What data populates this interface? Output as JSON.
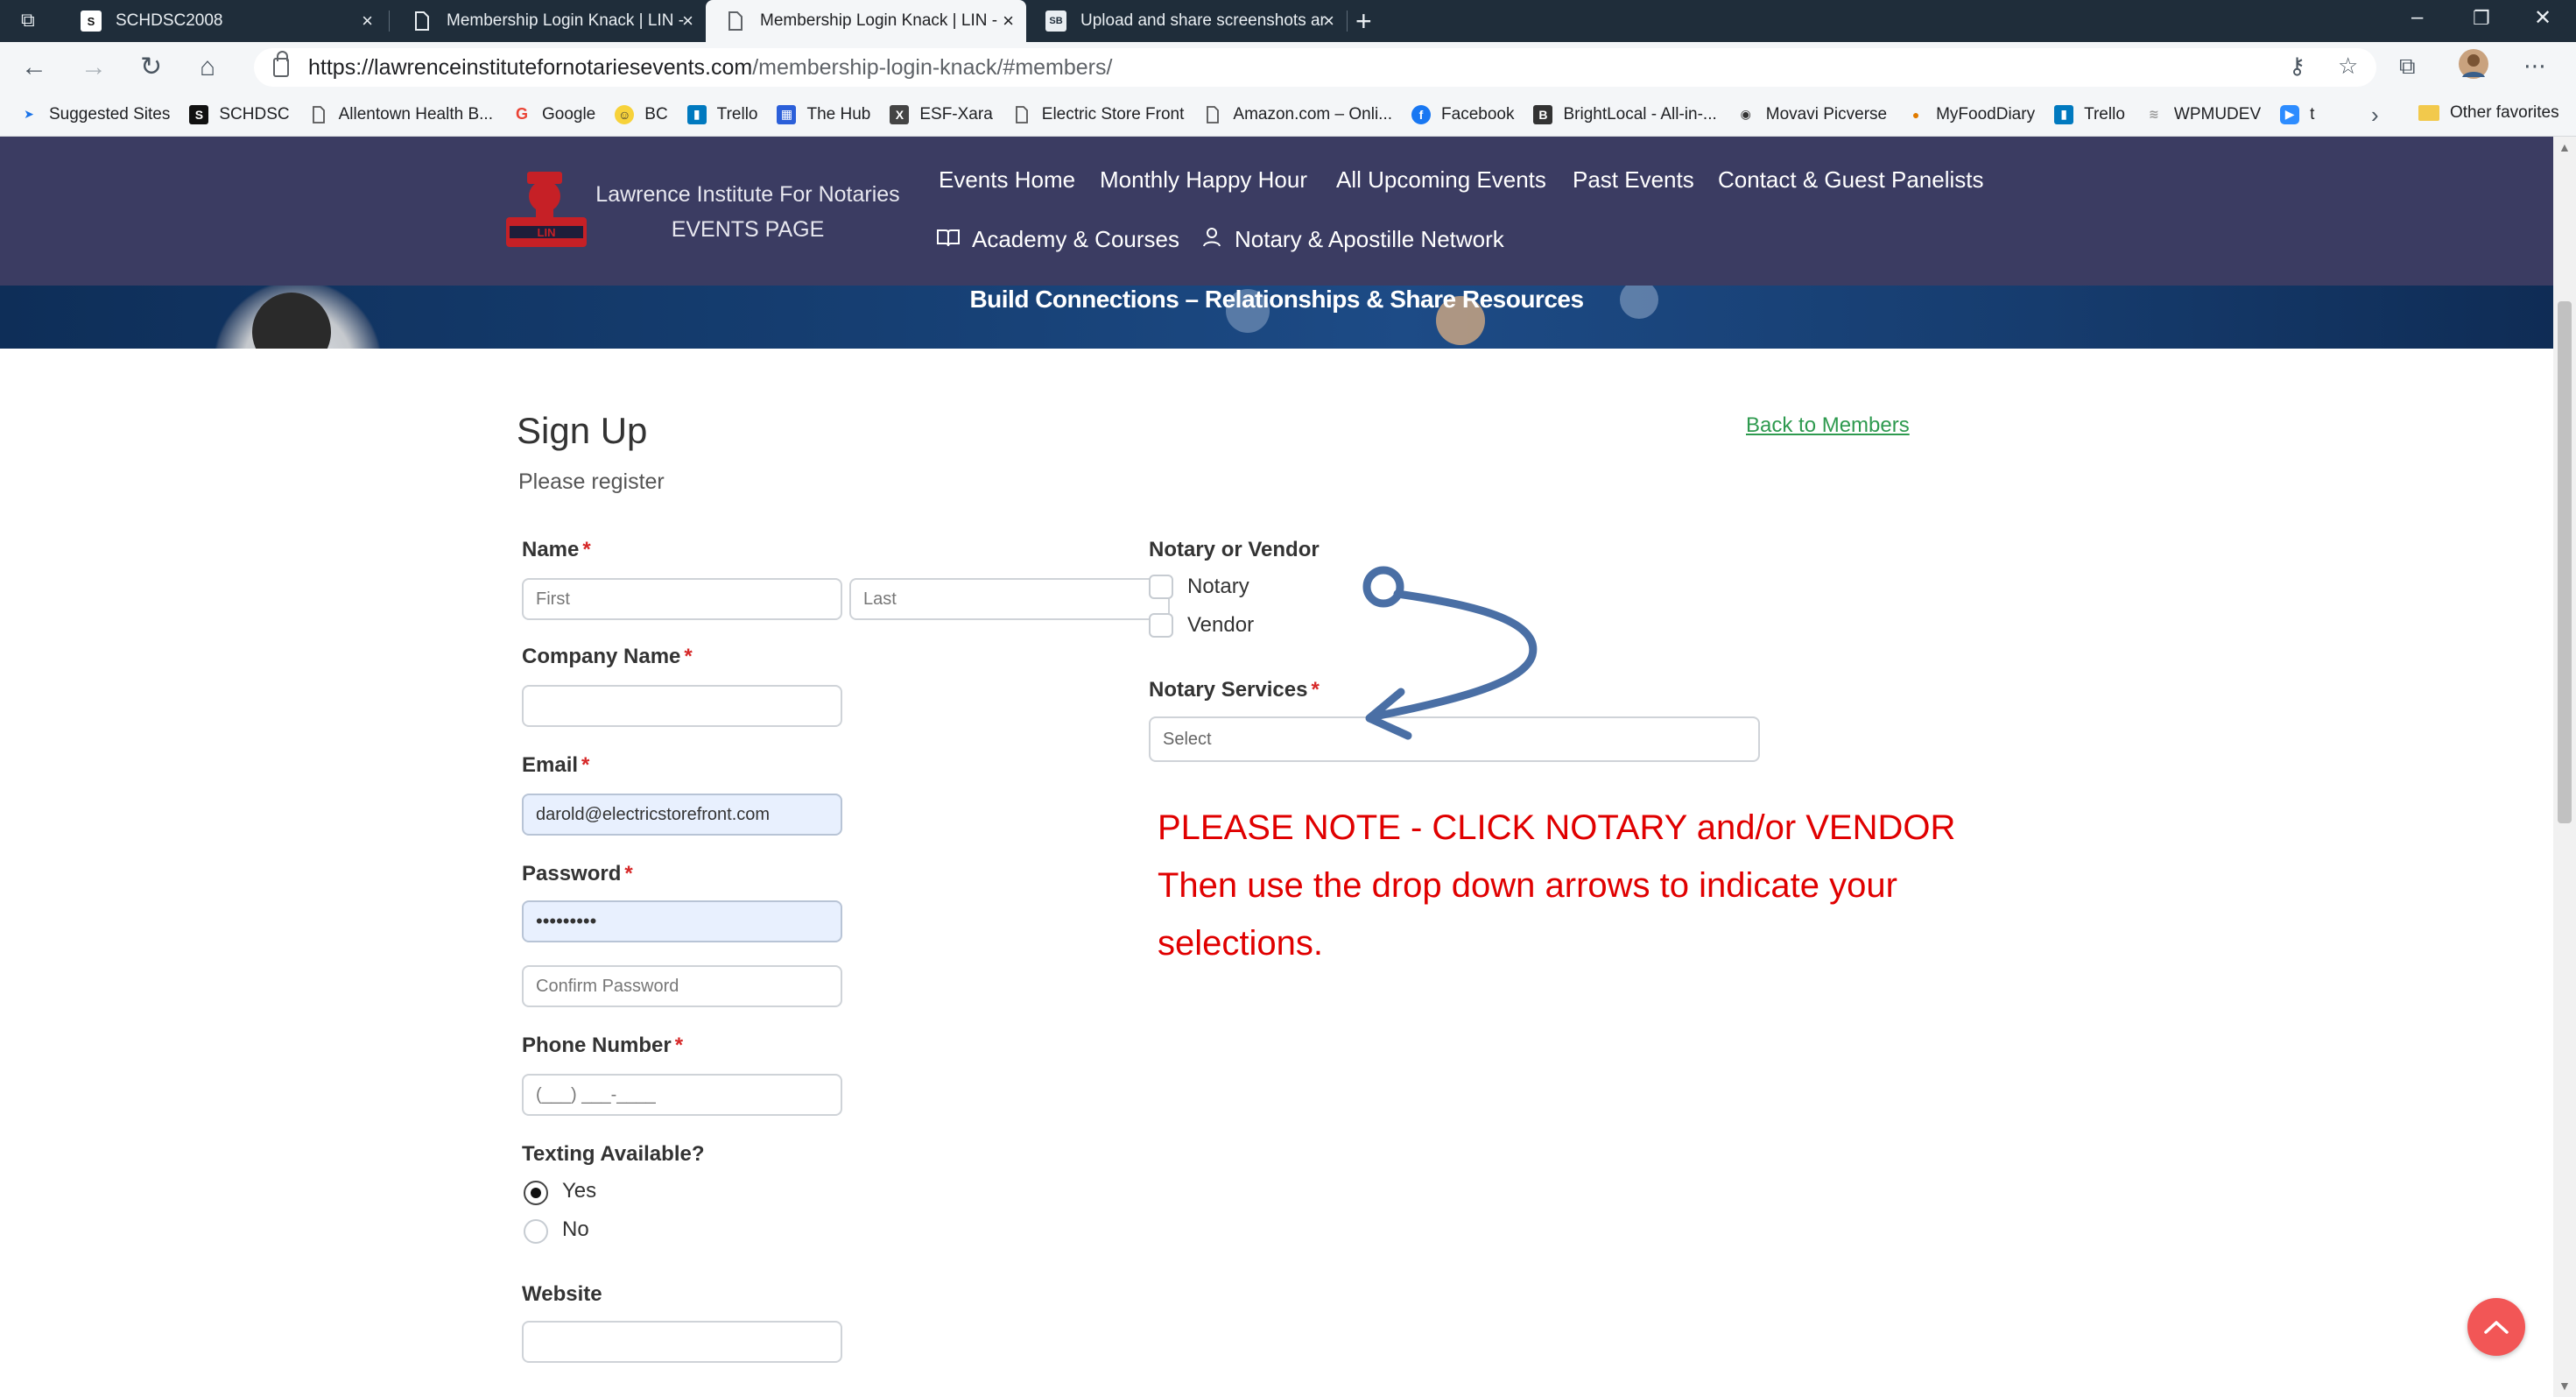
{
  "browser": {
    "tabs": [
      {
        "title": "SCHDSC2008",
        "icon": "s-favicon"
      },
      {
        "title": "Membership Login Knack | LIN -",
        "icon": "page-icon"
      },
      {
        "title": "Membership Login Knack | LIN -",
        "icon": "page-icon"
      },
      {
        "title": "Upload and share screenshots ar",
        "icon": "sb-favicon"
      }
    ],
    "sb_badge": "SB",
    "url_host": "https://lawrenceinstitutefornotariesevents.com",
    "url_path": "/membership-login-knack/#members/",
    "bookmarks": [
      {
        "label": "Suggested Sites",
        "icon": "suggested-icon",
        "color": "#1a73e8"
      },
      {
        "label": "SCHDSC",
        "icon": "s-favicon",
        "color": "#111111"
      },
      {
        "label": "Allentown Health B...",
        "icon": "page-icon",
        "color": "#555555"
      },
      {
        "label": "Google",
        "icon": "google-icon",
        "color": "#ea4335"
      },
      {
        "label": "BC",
        "icon": "bc-icon",
        "color": "#e6b800"
      },
      {
        "label": "Trello",
        "icon": "trello-icon",
        "color": "#0079bf"
      },
      {
        "label": "The Hub",
        "icon": "hub-icon",
        "color": "#2b5fd9"
      },
      {
        "label": "ESF-Xara",
        "icon": "xara-icon",
        "color": "#333333"
      },
      {
        "label": "Electric Store Front",
        "icon": "page-icon",
        "color": "#555555"
      },
      {
        "label": "Amazon.com – Onli...",
        "icon": "page-icon",
        "color": "#555555"
      },
      {
        "label": "Facebook",
        "icon": "facebook-icon",
        "color": "#1877f2"
      },
      {
        "label": "BrightLocal - All-in-...",
        "icon": "brightlocal-icon",
        "color": "#333333"
      },
      {
        "label": "Movavi Picverse",
        "icon": "movavi-icon",
        "color": "#333333"
      },
      {
        "label": "MyFoodDiary",
        "icon": "myfooddiary-icon",
        "color": "#e07b00"
      },
      {
        "label": "Trello",
        "icon": "trello-icon",
        "color": "#0079bf"
      },
      {
        "label": "WPMUDEV",
        "icon": "wpmudev-icon",
        "color": "#888888"
      },
      {
        "label": "t",
        "icon": "zoom-icon",
        "color": "#2d8cff"
      }
    ],
    "other_favorites": "Other favorites"
  },
  "site": {
    "brand_line1": "Lawrence Institute For Notaries",
    "brand_line2": "EVENTS PAGE",
    "logo_text": "LIN",
    "nav": {
      "events_home": "Events Home",
      "monthly_happy_hour": "Monthly Happy Hour",
      "all_upcoming_events": "All Upcoming Events",
      "past_events": "Past Events",
      "contact_guest_panelists": "Contact & Guest Panelists",
      "academy_courses": "Academy & Courses",
      "notary_network": "Notary & Apostille Network"
    },
    "banner_text": "Build Connections – Relationships & Share Resources"
  },
  "form": {
    "title": "Sign Up",
    "subtitle": "Please register",
    "back_link": "Back to Members",
    "required_mark": "*",
    "name": {
      "label": "Name",
      "first_placeholder": "First",
      "last_placeholder": "Last"
    },
    "company": {
      "label": "Company Name",
      "value": ""
    },
    "email": {
      "label": "Email",
      "value": "darold@electricstorefront.com"
    },
    "password": {
      "label": "Password",
      "value": "•••••••••",
      "confirm_placeholder": "Confirm Password"
    },
    "phone": {
      "label": "Phone Number",
      "placeholder": "(___) ___-____"
    },
    "texting": {
      "label": "Texting Available?",
      "options": [
        "Yes",
        "No"
      ],
      "selected": "Yes"
    },
    "website": {
      "label": "Website",
      "value": ""
    },
    "notary_or_vendor": {
      "label": "Notary or Vendor",
      "options": [
        "Notary",
        "Vendor"
      ]
    },
    "notary_services": {
      "label": "Notary Services",
      "placeholder": "Select"
    },
    "note": {
      "line1": "PLEASE NOTE - CLICK NOTARY and/or VENDOR",
      "line2": "Then use the drop down arrows to indicate your",
      "line3": "selections."
    }
  },
  "colors": {
    "header_bg": "#3b3c62",
    "note_red": "#e00000",
    "link_green": "#2e9a4f",
    "arrow_blue": "#4a6fa5",
    "to_top_button": "#f25656"
  }
}
